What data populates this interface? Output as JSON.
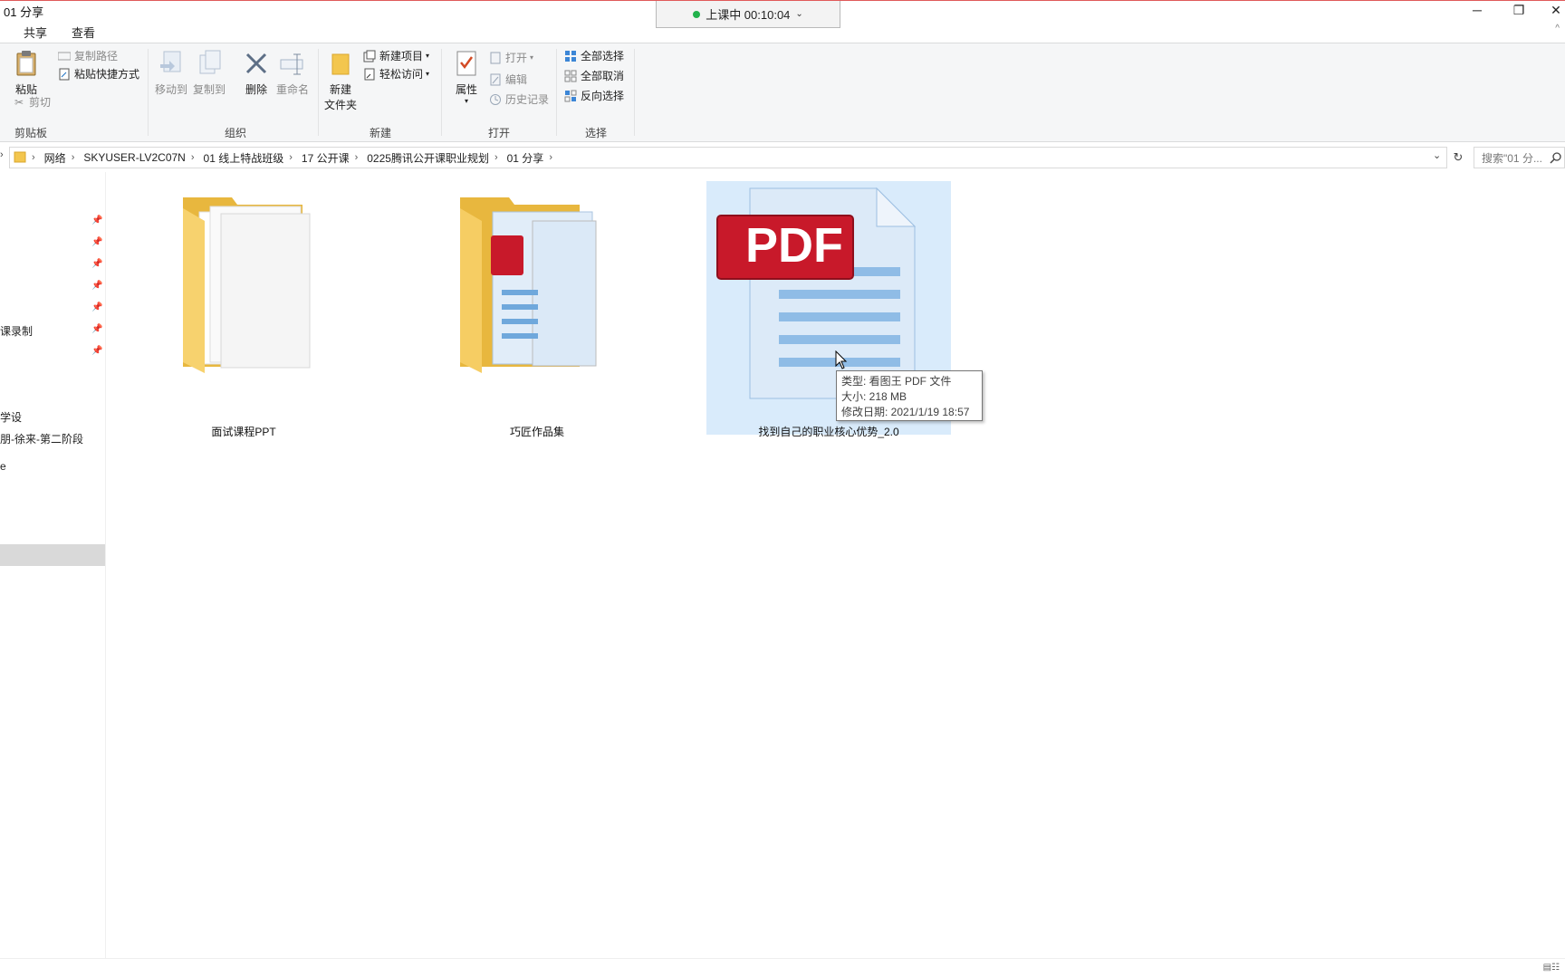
{
  "window": {
    "title": "01 分享",
    "minimize": "─",
    "maximize": "❐",
    "close": "✕"
  },
  "recording": {
    "text": "上课中 00:10:04",
    "chevron": "⌄"
  },
  "tabs": {
    "share": "共享",
    "view": "查看",
    "collapse": "^"
  },
  "ribbon": {
    "clipboard": {
      "label": "剪贴板",
      "paste": "粘贴",
      "copy_path": "复制路径",
      "paste_shortcut": "粘贴快捷方式",
      "cut": "剪切"
    },
    "organize": {
      "label": "组织",
      "move_to": "移动到",
      "copy_to": "复制到",
      "delete": "删除",
      "rename": "重命名"
    },
    "new": {
      "label": "新建",
      "new_folder_line1": "新建",
      "new_folder_line2": "文件夹",
      "new_item": "新建项目",
      "easy_access": "轻松访问"
    },
    "open": {
      "label": "打开",
      "properties": "属性",
      "open": "打开",
      "edit": "编辑",
      "history": "历史记录"
    },
    "select": {
      "label": "选择",
      "select_all": "全部选择",
      "select_none": "全部取消",
      "invert": "反向选择"
    }
  },
  "address": {
    "crumbs": [
      "网络",
      "SKYUSER-LV2C07N",
      "01 线上特战班级",
      "17 公开课",
      "0225腾讯公开课职业规划",
      "01 分享"
    ],
    "search_placeholder": "搜索\"01 分..."
  },
  "nav": {
    "items": [
      "课录制",
      "学设",
      "朋-徐来-第二阶段",
      "e"
    ]
  },
  "files": [
    {
      "name": "面试课程PPT",
      "type": "folder"
    },
    {
      "name": "巧匠作品集",
      "type": "folder-pdf"
    },
    {
      "name": "找到自己的职业核心优势_2.0",
      "type": "pdf",
      "icon_text": "PDF"
    }
  ],
  "tooltip": {
    "type": "类型: 看图王 PDF 文件",
    "size": "大小: 218 MB",
    "modified": "修改日期: 2021/1/19 18:57"
  },
  "status": {
    "view_icons": "▤☷"
  }
}
